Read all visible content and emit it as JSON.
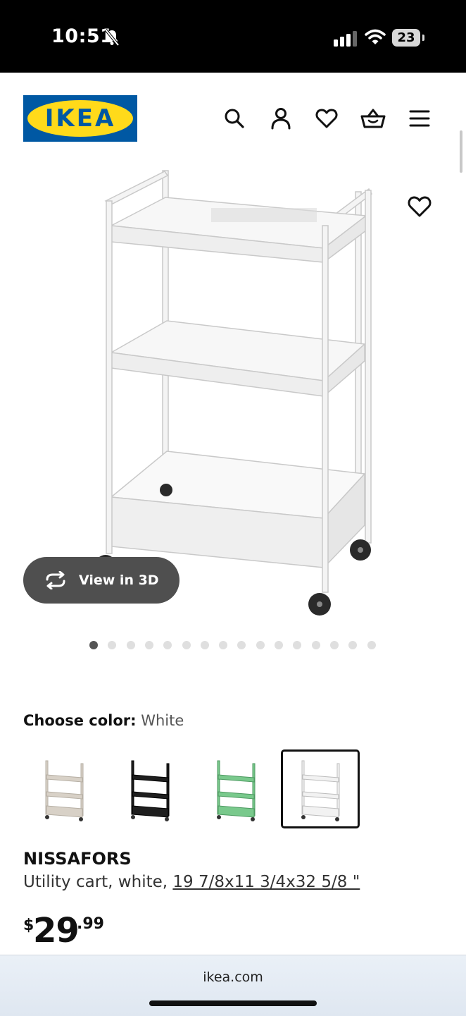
{
  "status_bar": {
    "time": "10:51",
    "battery": "23",
    "icons": [
      "bell-slash-icon",
      "cellular-signal-icon",
      "wifi-icon",
      "battery-icon"
    ]
  },
  "header": {
    "logo_text": "IKEA",
    "icons": [
      "search-icon",
      "account-icon",
      "heart-icon",
      "basket-icon",
      "menu-icon"
    ]
  },
  "gallery": {
    "view_3d_label": "View in 3D",
    "image_count": 16,
    "active_index": 0
  },
  "color_chooser": {
    "label": "Choose color:",
    "selected": "White",
    "options": [
      {
        "name": "beige",
        "color": "#d8d1c7"
      },
      {
        "name": "black",
        "color": "#1e1e1e"
      },
      {
        "name": "green",
        "color": "#79c98c"
      },
      {
        "name": "white",
        "color": "#f2f2f2"
      }
    ]
  },
  "product": {
    "name": "NISSAFORS",
    "description": "Utility cart, white, ",
    "dimensions": "19 7/8x11 3/4x32 5/8 \"",
    "price_currency": "$",
    "price_integer": "29",
    "price_decimal": ".99"
  },
  "browser": {
    "url": "ikea.com"
  },
  "colors": {
    "brand_blue": "#0058a3",
    "brand_yellow": "#ffda1a",
    "button_dark": "#4f4f4f"
  }
}
